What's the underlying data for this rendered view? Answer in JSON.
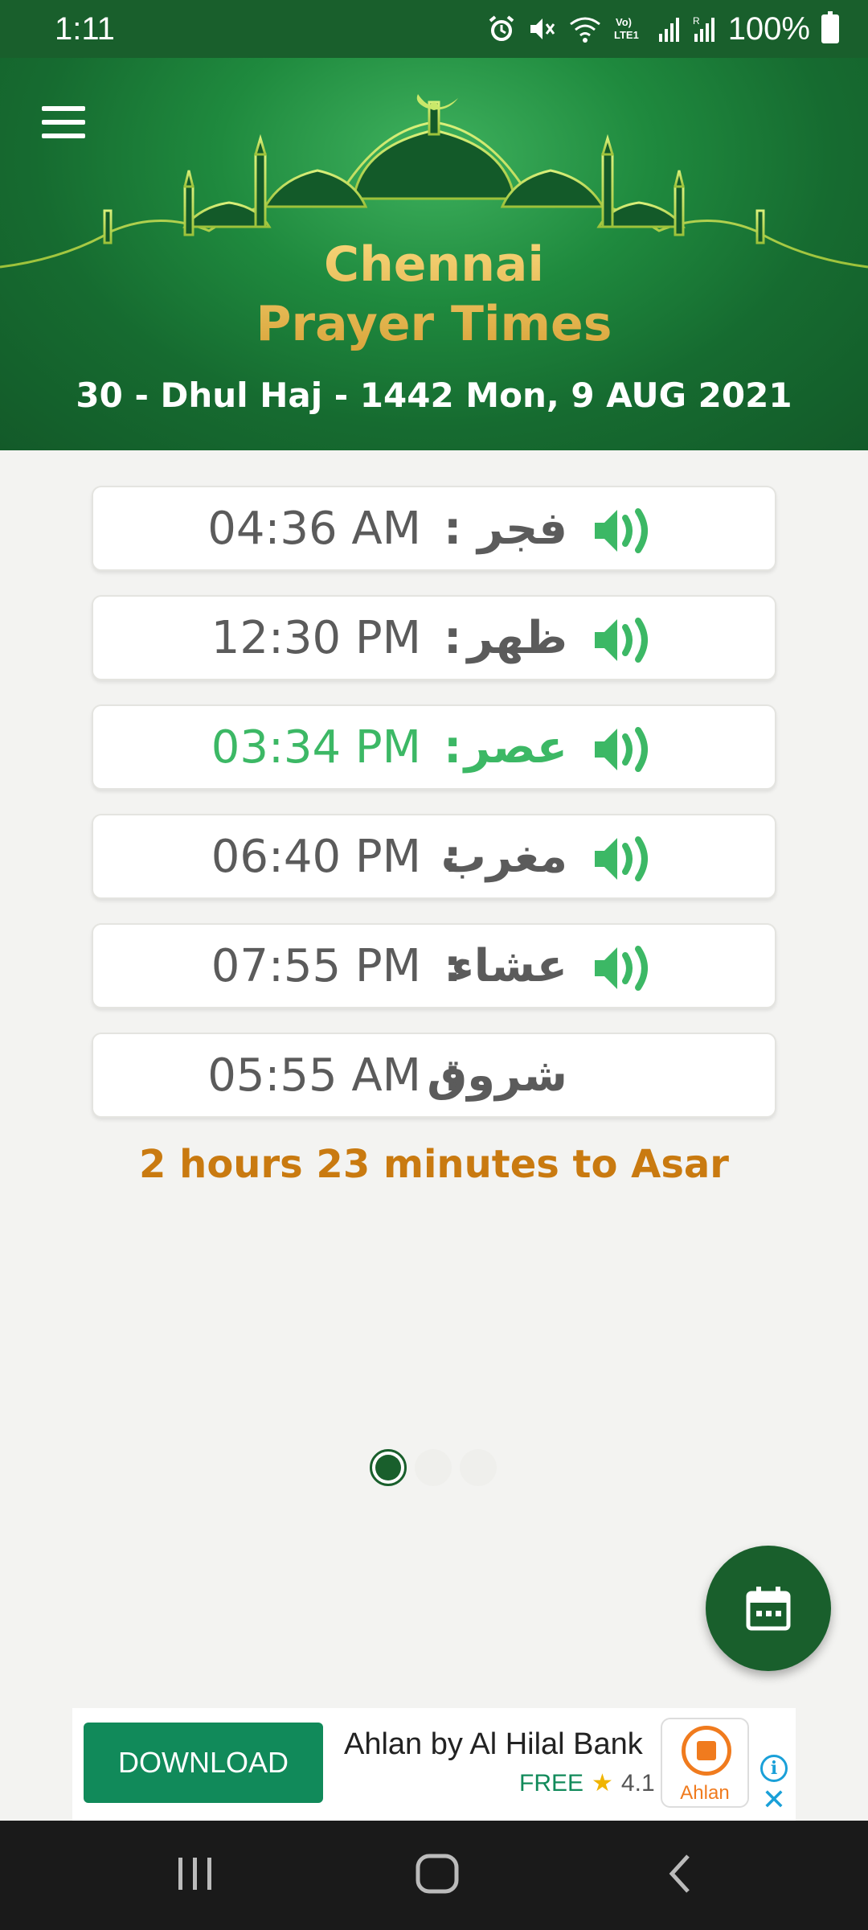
{
  "status_bar": {
    "time": "1:11",
    "battery": "100%",
    "icons": [
      "alarm-icon",
      "mute-icon",
      "wifi-icon",
      "volte-icon",
      "signal-icon",
      "signal-roaming-icon",
      "battery-icon"
    ]
  },
  "header": {
    "title_line1": "Chennai",
    "title_line2": "Prayer Times",
    "hijri_date": "30 - Dhul Haj - 1442",
    "gregorian_date": "Mon, 9 AUG 2021"
  },
  "prayers": [
    {
      "time": "04:36 AM",
      "name": "فجر",
      "sound": true,
      "active": false
    },
    {
      "time": "12:30 PM",
      "name": "ظهر",
      "sound": true,
      "active": false
    },
    {
      "time": "03:34 PM",
      "name": "عصر",
      "sound": true,
      "active": true
    },
    {
      "time": "06:40 PM",
      "name": "مغرب",
      "sound": true,
      "active": false
    },
    {
      "time": "07:55 PM",
      "name": "عشاء",
      "sound": true,
      "active": false
    },
    {
      "time": "05:55 AM",
      "name": "شروق",
      "sound": false,
      "active": false
    }
  ],
  "separator": ":",
  "countdown": "2 hours 23 minutes to Asar",
  "pager": {
    "current": 1,
    "total": 3
  },
  "fab": {
    "icon": "calendar-icon"
  },
  "ad": {
    "download_label": "DOWNLOAD",
    "title": "Ahlan by Al Hilal Bank",
    "price": "FREE",
    "rating": "4.1",
    "logo_text": "Ahlan"
  },
  "colors": {
    "primary_green": "#195f2c",
    "active_green": "#3cb865",
    "countdown_orange": "#c97a10",
    "title_gold": "#f1c25d",
    "ad_green": "#118a5a"
  }
}
